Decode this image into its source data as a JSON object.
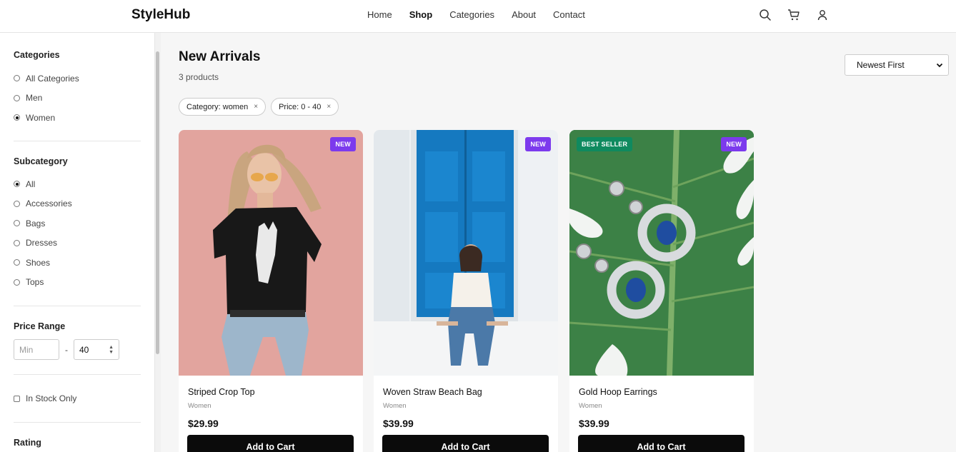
{
  "header": {
    "logo": "StyleHub",
    "nav": [
      "Home",
      "Shop",
      "Categories",
      "About",
      "Contact"
    ],
    "active_nav": "Shop",
    "icons": [
      "search-icon",
      "cart-icon",
      "user-icon"
    ]
  },
  "sidebar": {
    "categories": {
      "title": "Categories",
      "options": [
        {
          "label": "All Categories",
          "checked": false
        },
        {
          "label": "Men",
          "checked": false
        },
        {
          "label": "Women",
          "checked": true
        }
      ]
    },
    "subcategory": {
      "title": "Subcategory",
      "options": [
        {
          "label": "All",
          "checked": true
        },
        {
          "label": "Accessories",
          "checked": false
        },
        {
          "label": "Bags",
          "checked": false
        },
        {
          "label": "Dresses",
          "checked": false
        },
        {
          "label": "Shoes",
          "checked": false
        },
        {
          "label": "Tops",
          "checked": false
        }
      ]
    },
    "price": {
      "title": "Price Range",
      "min_placeholder": "Min",
      "min_value": "",
      "separator": "-",
      "max_value": "40"
    },
    "stock": {
      "label": "In Stock Only",
      "checked": false
    },
    "rating": {
      "title": "Rating"
    }
  },
  "main": {
    "title": "New Arrivals",
    "count": "3 products",
    "sort": {
      "selected": "Newest First"
    },
    "chips": [
      {
        "label": "Category: women",
        "remove": "×"
      },
      {
        "label": "Price: 0 - 40",
        "remove": "×"
      }
    ],
    "products": [
      {
        "name": "Striped Crop Top",
        "category": "Women",
        "price": "$29.99",
        "badges": [
          "NEW"
        ],
        "button": "Add to Cart"
      },
      {
        "name": "Woven Straw Beach Bag",
        "category": "Women",
        "price": "$39.99",
        "badges": [
          "NEW"
        ],
        "button": "Add to Cart"
      },
      {
        "name": "Gold Hoop Earrings",
        "category": "Women",
        "price": "$39.99",
        "badges": [
          "BEST SELLER",
          "NEW"
        ],
        "button": "Add to Cart"
      }
    ]
  },
  "colors": {
    "accent_new": "#7c3aed",
    "accent_best": "#0f8a5f",
    "button": "#0b0b0b"
  }
}
